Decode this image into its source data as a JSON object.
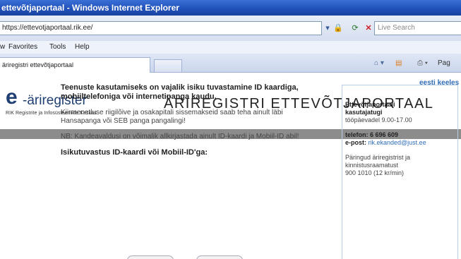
{
  "window": {
    "title": "ettevõtjaportaal - Windows Internet Explorer"
  },
  "address_bar": {
    "url": "https://ettevotjaportaal.rik.ee/",
    "search_placeholder": "Live Search"
  },
  "menu": [
    "Favorites",
    "Tools",
    "Help"
  ],
  "menu_partial": "w",
  "tab": {
    "title": "äriregistri ettevõtjaportaal"
  },
  "toolbar": {
    "page_label": "Pag"
  },
  "page": {
    "language_link": "eesti keeles",
    "logo_letter": "e",
    "logo_word": "-äriregister",
    "logo_subtitle": "RIK Registrite ja Infosüsteemide Keskus",
    "title": "ÄRIREGISTRI ETTEVÕTJAPORTAAL",
    "intro_heading": "Teenuste kasutamiseks on vajalik isiku tuvastamine ID kaardiga, mobiiltelefoniga või internetipanga kaudu.",
    "notice_1": "Kiirmenetluse riigilõive ja osakapitali sissemakseid saab teha ainult läbi Hansapanga või SEB panga pangalingi!",
    "notice_2": "NB: Kandeavaldusi on võimalik allkirjastada ainult ID-kaardi ja Mobiil-ID abil!",
    "id_heading": "Isikutuvastus ID-kaardi või Mobiil-ID'ga:"
  },
  "sidebar": {
    "support_title_1": "Ettevõtjaportaali",
    "support_title_2": "kasutajatugi",
    "hours": "tööpäevadel 9.00-17.00",
    "phone": "telefon: 6 696 609",
    "email_label": "e-post:",
    "email": "rik.ekanded@just.ee",
    "info_1": "Päringud äriregistrist ja",
    "info_2": "kinnistusraamatust",
    "info_3": "900 1010 (12 kr/min)"
  }
}
